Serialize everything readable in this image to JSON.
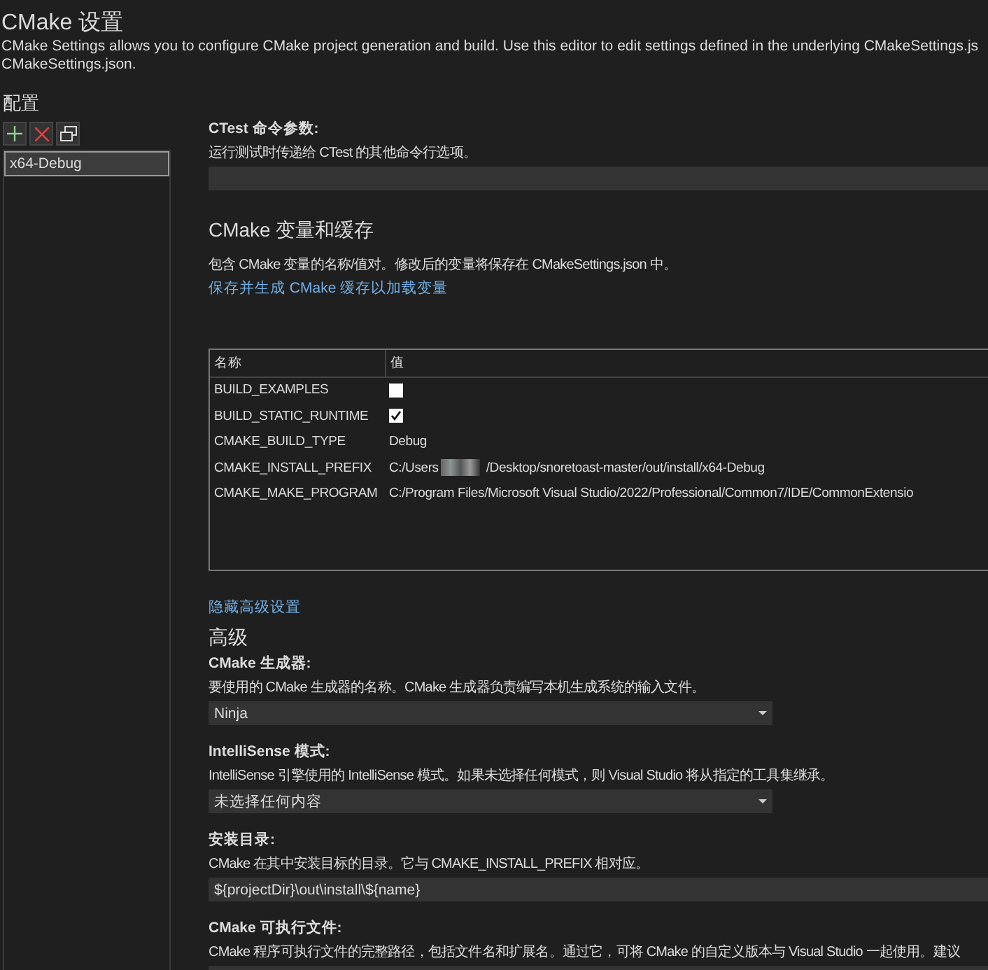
{
  "header": {
    "title": "CMake 设置",
    "description_lines": [
      "CMake Settings allows you to configure CMake project generation and build. Use this editor to edit settings defined in the underlying CMakeSettings.js",
      "CMakeSettings.json."
    ]
  },
  "sidebar": {
    "title": "配置",
    "configurations": [
      {
        "label": "x64-Debug",
        "selected": true
      }
    ]
  },
  "ctest": {
    "label": "CTest 命令参数:",
    "description": "运行测试时传递给 CTest 的其他命令行选项。"
  },
  "variables": {
    "title": "CMake 变量和缓存",
    "description": "包含 CMake 变量的名称/值对。修改后的变量将保存在 CMakeSettings.json 中。",
    "link": "保存并生成 CMake 缓存以加载变量",
    "table": {
      "columns": [
        "名称",
        "值"
      ],
      "rows": [
        {
          "name": "BUILD_EXAMPLES",
          "kind": "checkbox",
          "checked": false
        },
        {
          "name": "BUILD_STATIC_RUNTIME",
          "kind": "checkbox",
          "checked": true
        },
        {
          "name": "CMAKE_BUILD_TYPE",
          "kind": "text",
          "value_parts": [
            "Debug"
          ]
        },
        {
          "name": "CMAKE_INSTALL_PREFIX",
          "kind": "text",
          "value_parts": [
            "C:/Users",
            "/Desktop/snoretoast-master/out/install/x64-Debug"
          ]
        },
        {
          "name": "CMAKE_MAKE_PROGRAM",
          "kind": "text",
          "value_parts": [
            "C:/Program Files/Microsoft Visual Studio/2022/Professional/Common7/IDE/CommonExtensio"
          ]
        }
      ]
    }
  },
  "advanced": {
    "link": "隐藏高级设置",
    "title": "高级",
    "settings": [
      {
        "kind": "dropdown",
        "label": "CMake 生成器:",
        "description": "要使用的 CMake 生成器的名称。CMake 生成器负责编写本机生成系统的输入文件。",
        "value": "Ninja"
      },
      {
        "kind": "dropdown",
        "label": "IntelliSense 模式:",
        "description": "IntelliSense 引擎使用的 IntelliSense 模式。如果未选择任何模式，则 Visual Studio 将从指定的工具集继承。",
        "value": "未选择任何内容"
      },
      {
        "kind": "input",
        "label": "安装目录:",
        "description": "CMake 在其中安装目标的目录。它与 CMAKE_INSTALL_PREFIX 相对应。",
        "value": "${projectDir}\\out\\install\\${name}"
      },
      {
        "kind": "input",
        "label": "CMake 可执行文件:",
        "description": "CMake 程序可执行文件的完整路径，包括文件名和扩展名。通过它，可将 CMake 的自定义版本与 Visual Studio 一起使用。建议"
      }
    ]
  }
}
